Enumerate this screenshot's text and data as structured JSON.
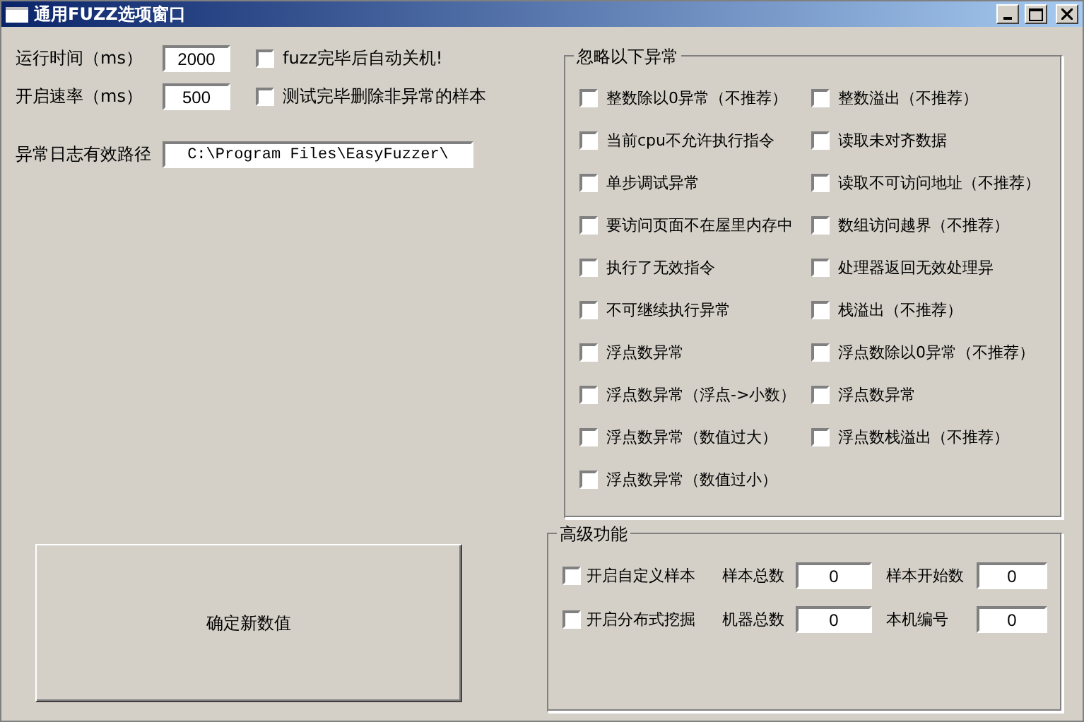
{
  "window": {
    "title": "通用FUZZ选项窗口"
  },
  "settings": [
    {
      "label": "运行时间（ms）",
      "value": "2000",
      "option": {
        "label": "fuzz完毕后自动关机!",
        "checked": false
      }
    },
    {
      "label": "开启速率（ms）",
      "value": "500",
      "option": {
        "label": "测试完毕删除非异常的样本",
        "checked": false
      }
    }
  ],
  "log_path": {
    "label": "异常日志有效路径",
    "value": "C:\\Program Files\\EasyFuzzer\\"
  },
  "ignore_group": {
    "title": "忽略以下异常",
    "options": [
      {
        "label": "整数除以0异常（不推荐）",
        "checked": false
      },
      {
        "label": "整数溢出（不推荐）",
        "checked": false
      },
      {
        "label": "当前cpu不允许执行指令",
        "checked": false
      },
      {
        "label": "读取未对齐数据",
        "checked": false
      },
      {
        "label": "单步调试异常",
        "checked": false
      },
      {
        "label": "读取不可访问地址（不推荐）",
        "checked": false
      },
      {
        "label": "要访问页面不在屋里内存中",
        "checked": false
      },
      {
        "label": "数组访问越界（不推荐）",
        "checked": false
      },
      {
        "label": "执行了无效指令",
        "checked": false
      },
      {
        "label": "处理器返回无效处理异",
        "checked": false
      },
      {
        "label": "不可继续执行异常",
        "checked": false
      },
      {
        "label": "栈溢出（不推荐）",
        "checked": false
      },
      {
        "label": "浮点数异常",
        "checked": false
      },
      {
        "label": "浮点数除以0异常（不推荐）",
        "checked": false
      },
      {
        "label": "浮点数异常（浮点->小数）",
        "checked": false
      },
      {
        "label": "浮点数异常",
        "checked": false
      },
      {
        "label": "浮点数异常（数值过大）",
        "checked": false
      },
      {
        "label": "浮点数栈溢出（不推荐）",
        "checked": false
      },
      {
        "label": "浮点数异常（数值过小）",
        "checked": false
      }
    ]
  },
  "confirm_button": "确定新数值",
  "advanced": {
    "title": "高级功能",
    "rows": [
      {
        "option": {
          "label": "开启自定义样本",
          "checked": false
        },
        "fields": [
          {
            "label": "样本总数",
            "value": "0"
          },
          {
            "label": "样本开始数",
            "value": "0"
          }
        ]
      },
      {
        "option": {
          "label": "开启分布式挖掘",
          "checked": false
        },
        "fields": [
          {
            "label": "机器总数",
            "value": "0"
          },
          {
            "label": "本机编号",
            "value": "0"
          }
        ]
      }
    ]
  }
}
